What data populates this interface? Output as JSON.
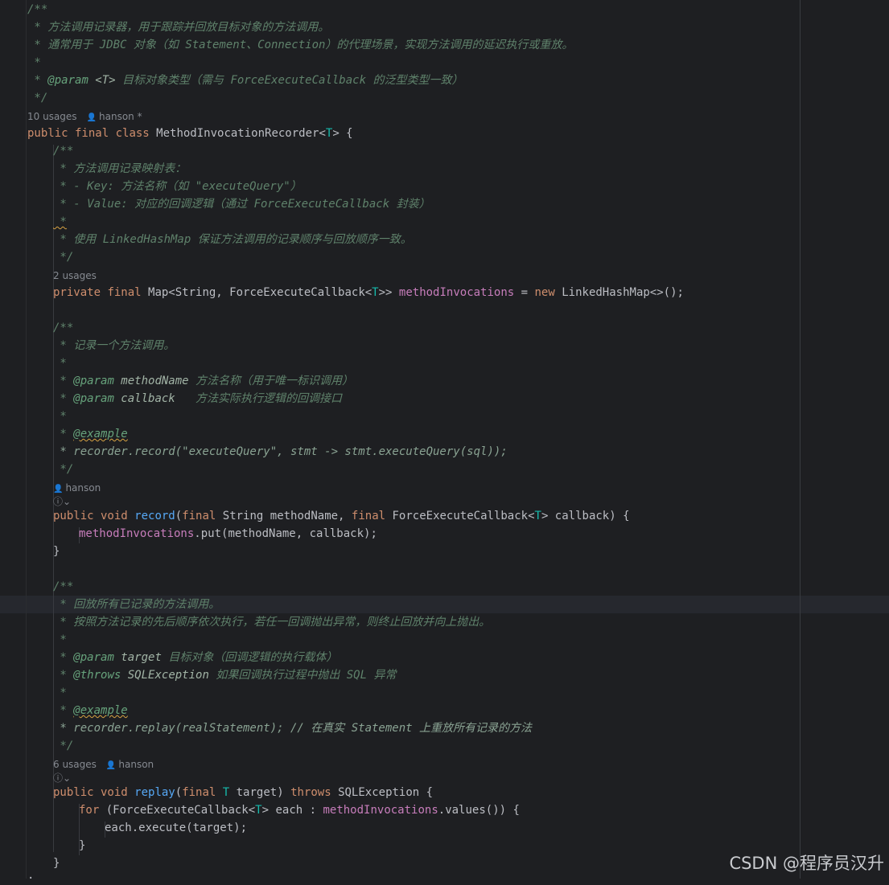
{
  "class_doc": {
    "open": "/**",
    "line1": " * 方法调用记录器，用于跟踪并回放目标对象的方法调用。",
    "line2": " * 通常用于 JDBC 对象（如 Statement、Connection）的代理场景，实现方法调用的延迟执行或重放。",
    "line3": " *",
    "param_prefix": " * ",
    "param_tag": "@param",
    "param_name": " <T>",
    "param_desc": " 目标对象类型（需与 ForceExecuteCallback 的泛型类型一致）",
    "close": " */"
  },
  "class_meta": {
    "usages": "10 usages",
    "author": "hanson *"
  },
  "class_decl": {
    "kw_public": "public",
    "kw_final": " final",
    "kw_class": " class",
    "name": " MethodInvocationRecorder<",
    "type_param": "T",
    "rest": "> {"
  },
  "field_doc": {
    "open": "/**",
    "line1": " * 方法调用记录映射表：",
    "line2": " * - Key: 方法名称（如 \"executeQuery\"）",
    "line3": " * - Value: 对应的回调逻辑（通过 ForceExecuteCallback 封装）",
    "line4_star": " *",
    "line5": " * 使用 LinkedHashMap 保证方法调用的记录顺序与回放顺序一致。",
    "close": " */"
  },
  "field_meta": {
    "usages": "2 usages"
  },
  "field_decl": {
    "kw_private": "private",
    "kw_final": " final",
    "type": " Map<String, ForceExecuteCallback<",
    "type_param": "T",
    "type_end": ">> ",
    "name": "methodInvocations",
    "assign": " = ",
    "kw_new": "new",
    "init": " LinkedHashMap<>();"
  },
  "record_doc": {
    "open": "/**",
    "line1": " * 记录一个方法调用。",
    "star": " *",
    "p1_prefix": " * ",
    "p1_tag": "@param",
    "p1_name": " methodName",
    "p1_desc": " 方法名称（用于唯一标识调用）",
    "p2_prefix": " * ",
    "p2_tag": "@param",
    "p2_name": " callback",
    "p2_desc": "   方法实际执行逻辑的回调接口",
    "ex_prefix": " * ",
    "ex_tag": "@example",
    "ex_code": " * recorder.record(\"executeQuery\", stmt -> stmt.executeQuery(sql));",
    "close": " */"
  },
  "record_meta": {
    "author": "hanson",
    "hint": "ⓘ⌄"
  },
  "record_decl": {
    "kw_public": "public",
    "kw_void": " void",
    "name": " record",
    "open": "(",
    "kw_final1": "final",
    "p1": " String methodName, ",
    "kw_final2": "final",
    "p2": " ForceExecuteCallback<",
    "type_param": "T",
    "p2_end": "> callback) {"
  },
  "record_body": {
    "field": "methodInvocations",
    "call": ".put(methodName, callback);"
  },
  "record_close": "}",
  "replay_doc": {
    "open": "/**",
    "line1": " * 回放所有已记录的方法调用。",
    "line2": " * 按照方法记录的先后顺序依次执行，若任一回调抛出异常，则终止回放并向上抛出。",
    "star": " *",
    "p_prefix": " * ",
    "p_tag": "@param",
    "p_name": " target",
    "p_desc": " 目标对象（回调逻辑的执行载体）",
    "t_prefix": " * ",
    "t_tag": "@throws",
    "t_name": " SQLException",
    "t_desc": " 如果回调执行过程中抛出 SQL 异常",
    "ex_prefix": " * ",
    "ex_tag": "@example",
    "ex_code": " * recorder.replay(realStatement); // 在真实 Statement 上重放所有记录的方法",
    "close": " */"
  },
  "replay_meta": {
    "usages": "6 usages",
    "author": "hanson",
    "hint": "ⓘ⌄"
  },
  "replay_decl": {
    "kw_public": "public",
    "kw_void": " void",
    "name": " replay",
    "open": "(",
    "kw_final": "final",
    "type_param": " T",
    "param": " target) ",
    "kw_throws": "throws",
    "rest": " SQLException {"
  },
  "for_line": {
    "kw_for": "for",
    "head": " (ForceExecuteCallback<",
    "type_param": "T",
    "mid": "> each : ",
    "field": "methodInvocations",
    "tail": ".values()) {"
  },
  "loop_body": "each.execute(target);",
  "for_close": "}",
  "replay_close": "}",
  "watermark": "CSDN @程序员汉升"
}
